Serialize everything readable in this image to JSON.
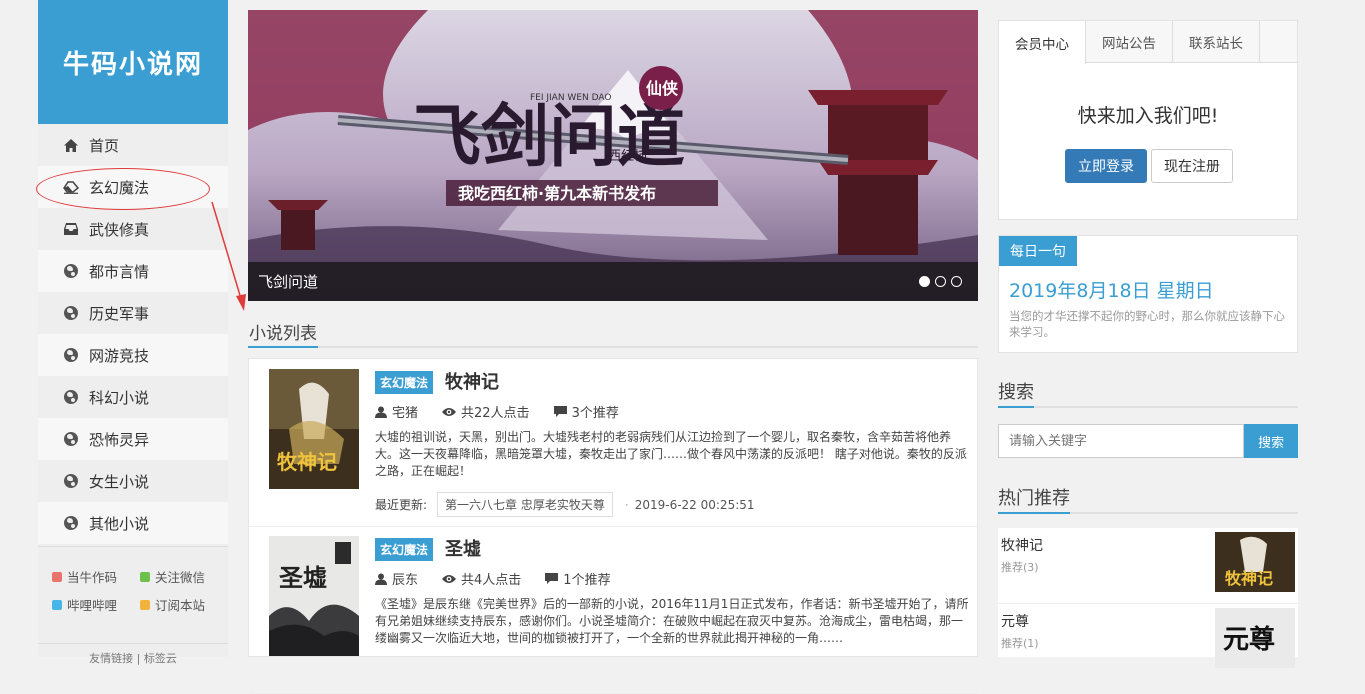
{
  "site": {
    "logo_text": "牛码小说网"
  },
  "nav": {
    "items": [
      {
        "label": "首页",
        "icon": "home-icon"
      },
      {
        "label": "玄幻魔法",
        "icon": "eraser-icon"
      },
      {
        "label": "武侠修真",
        "icon": "inbox-icon"
      },
      {
        "label": "都市言情",
        "icon": "globe-icon"
      },
      {
        "label": "历史军事",
        "icon": "globe-icon"
      },
      {
        "label": "网游竞技",
        "icon": "globe-icon"
      },
      {
        "label": "科幻小说",
        "icon": "globe-icon"
      },
      {
        "label": "恐怖灵异",
        "icon": "globe-icon"
      },
      {
        "label": "女生小说",
        "icon": "globe-icon"
      },
      {
        "label": "其他小说",
        "icon": "globe-icon"
      }
    ]
  },
  "sidebar_footer": {
    "links": [
      {
        "label": "当牛作码",
        "color": "#e8746b"
      },
      {
        "label": "关注微信",
        "color": "#6ec04c"
      },
      {
        "label": "哔哩哔哩",
        "color": "#46b5e8"
      },
      {
        "label": "订阅本站",
        "color": "#f0b43c"
      }
    ],
    "friend_links": "友情链接 | 标签云"
  },
  "banner": {
    "caption": "飞剑问道",
    "image_text": {
      "title": "飞剑问道",
      "pinyin": "FEI JIAN\nWEN DAO",
      "badge": "仙侠",
      "author_seal": "西红柿",
      "subtitle": "我吃西红柿·第九本新书发布"
    },
    "slides": 3,
    "active_slide": 0
  },
  "list": {
    "title": "小说列表",
    "novels": [
      {
        "category": "玄幻魔法",
        "title": "牧神记",
        "author": "宅猪",
        "clicks": "共22人点击",
        "recommends": "3个推荐",
        "description": "大墟的祖训说，天黑，别出门。大墟残老村的老弱病残们从江边捡到了一个婴儿，取名秦牧，含辛茹苦将他养大。这一天夜幕降临，黑暗笼罩大墟，秦牧走出了家门……做个春风中荡漾的反派吧！ 瞎子对他说。秦牧的反派之路，正在崛起！",
        "latest_label": "最近更新:",
        "latest_chapter": "第一六八七章 忠厚老实牧天尊",
        "latest_time": "2019-6-22 00:25:51",
        "cover_text": "牧神记"
      },
      {
        "category": "玄幻魔法",
        "title": "圣墟",
        "author": "辰东",
        "clicks": "共4人点击",
        "recommends": "1个推荐",
        "description": "《圣墟》是辰东继《完美世界》后的一部新的小说，2016年11月1日正式发布，作者话：新书圣墟开始了，请所有兄弟姐妹继续支持辰东，感谢你们。小说圣墟简介：在破败中崛起在寂灭中复苏。沧海成尘，雷电枯竭，那一缕幽雾又一次临近大地，世间的枷锁被打开了，一个全新的世界就此揭开神秘的一角……",
        "cover_text": "圣墟"
      }
    ]
  },
  "member": {
    "tabs": [
      "会员中心",
      "网站公告",
      "联系站长"
    ],
    "active_tab": 0,
    "join_text": "快来加入我们吧!",
    "login_label": "立即登录",
    "register_label": "现在注册"
  },
  "daily": {
    "label": "每日一句",
    "date": "2019年8月18日 星期日",
    "quote": "当您的才华还撑不起你的野心时，那么你就应该静下心来学习。"
  },
  "search": {
    "title": "搜索",
    "placeholder": "请输入关键字",
    "button_label": "搜索"
  },
  "hot": {
    "title": "热门推荐",
    "items": [
      {
        "title": "牧神记",
        "sub": "推荐(3)",
        "cover_text": "牧神记"
      },
      {
        "title": "元尊",
        "sub": "推荐(1)",
        "cover_text": "元尊"
      }
    ]
  },
  "colors": {
    "brand": "#3a9ed3",
    "login_button": "#337ab7",
    "annotation": "#e03b3b"
  }
}
